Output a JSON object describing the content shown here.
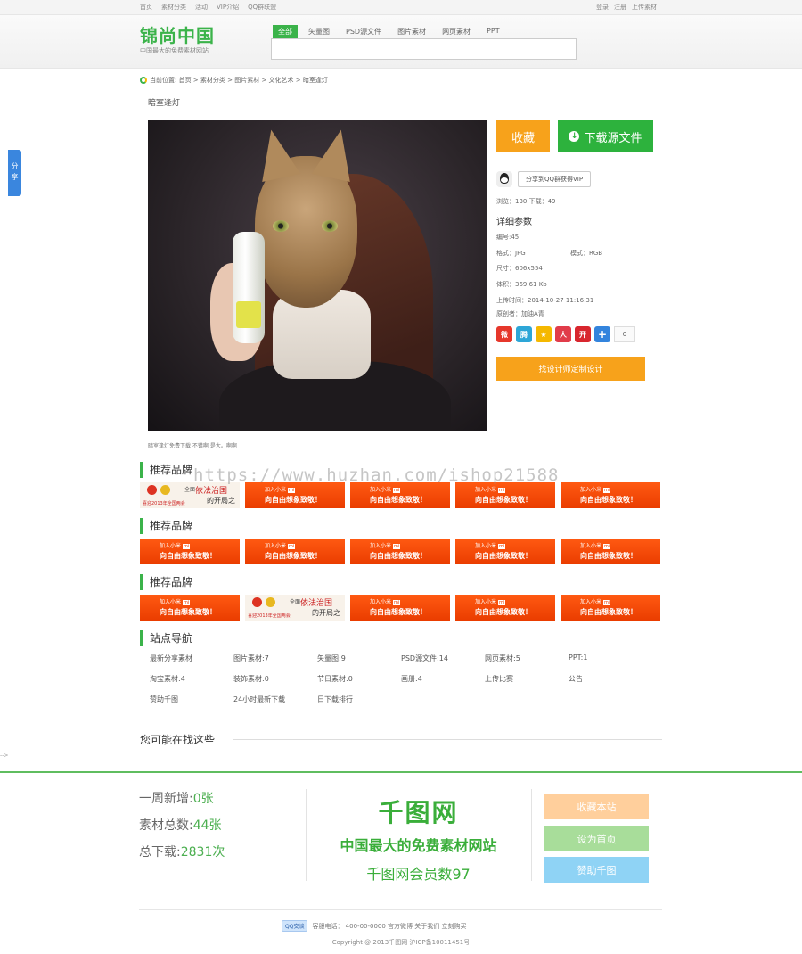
{
  "topbar": {
    "left_links": [
      "首页",
      "素材分类",
      "活动",
      "VIP介绍",
      "QQ群联盟"
    ],
    "right_links": [
      "登录",
      "注册",
      "上传素材"
    ]
  },
  "header": {
    "logo_name": "锦尚中国",
    "logo_slogan": "中国最大的免费素材网站",
    "tabs": [
      "全部",
      "矢量图",
      "PSD源文件",
      "图片素材",
      "网页素材",
      "PPT"
    ],
    "active_tab": "全部",
    "search_value": ""
  },
  "breadcrumb": "当前位置: 首页 > 素材分类 > 图片素材 > 文化艺术 > 暗室逢灯",
  "page_title": "暗室逢灯",
  "image_caption": "暗室逢灯免费下载 不错啊 是大。啊啊",
  "actions": {
    "favorite": "收藏",
    "download": "下载源文件",
    "qq_share": "分享到QQ群获得VIP",
    "designer": "找设计师定制设计"
  },
  "stats": "浏览：130   下载：49",
  "details": {
    "title": "详细参数",
    "id": "编号:45",
    "format": "格式：JPG",
    "mode": "模式：RGB",
    "size": "尺寸：606x554",
    "volume": "体积：369.61 Kb",
    "upload_time": "上传时间：2014-10-27 11:16:31",
    "creator": "原创者：加油A青"
  },
  "share": {
    "count": "0"
  },
  "side_tab": "分享",
  "brand_sections": [
    {
      "title": "推荐品牌",
      "banners": [
        "light",
        "orange",
        "orange",
        "orange",
        "orange"
      ]
    },
    {
      "title": "推荐品牌",
      "banners": [
        "orange",
        "orange",
        "orange",
        "orange",
        "orange"
      ]
    },
    {
      "title": "推荐品牌",
      "banners": [
        "orange",
        "light",
        "orange",
        "orange",
        "orange"
      ]
    }
  ],
  "banner_text": {
    "orange_line1": "加入小米",
    "orange_mi": "mi",
    "orange_line2": "向自由想象致敬！",
    "light_t1": "全面",
    "light_t2": "依法治国",
    "light_t3": "的开局之",
    "light_t4": "喜迎2013年全国两会"
  },
  "site_nav": {
    "title": "站点导航",
    "items": [
      "最新分享素材",
      "图片素材:7",
      "矢量图:9",
      "PSD源文件:14",
      "网页素材:5",
      "PPT:1",
      "淘宝素材:4",
      "装饰素材:0",
      "节日素材:0",
      "画册:4",
      "上传比赛",
      "公告",
      "赞助千图",
      "24小时最新下载",
      "日下载排行"
    ]
  },
  "maybe_title": "您可能在找这些",
  "arrow_mark": "-->",
  "footer": {
    "week_new_label": "一周新增:",
    "week_new_value": "0张",
    "total_label": "素材总数:",
    "total_value": "44张",
    "downloads_label": "总下载:",
    "downloads_value": "2831次",
    "logo": "千图网",
    "slogan": "中国最大的免费素材网站",
    "members": "千图网会员数97",
    "btn_fav": "收藏本站",
    "btn_home": "设为首页",
    "btn_sponsor": "赞助千图",
    "qq_badge": "QQ交谈",
    "contact": "客服电话： 400-00-0000  官方微博  关于我们 立刻购买",
    "copyright": "Copyright @ 2013千图网 沪ICP备10011451号"
  },
  "watermark": "https://www.huzhan.com/ishop21588"
}
